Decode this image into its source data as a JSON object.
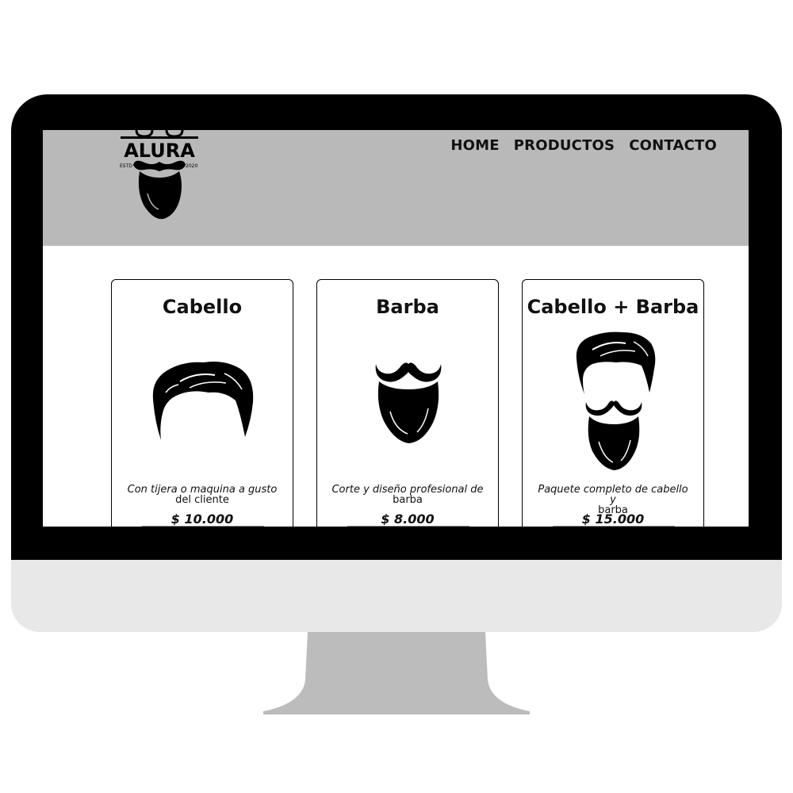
{
  "logo": {
    "brand": "ALURA",
    "estd_label": "ESTD",
    "year": "2020"
  },
  "nav": {
    "items": [
      {
        "label": "HOME"
      },
      {
        "label": "PRODUCTOS"
      },
      {
        "label": "CONTACTO"
      }
    ]
  },
  "cards": [
    {
      "title": "Cabello",
      "desc_italic": "Con tijera o maquina a gusto",
      "desc_rest": "del cliente",
      "price": "$ 10.000",
      "icon": "hair-icon"
    },
    {
      "title": "Barba",
      "desc_italic": "Corte y diseño profesional de",
      "desc_rest": "barba",
      "price": "$ 8.000",
      "icon": "beard-icon"
    },
    {
      "title": "Cabello + Barba",
      "desc_italic": "Paquete completo de cabello y",
      "desc_rest": "barba",
      "price": "$ 15.000",
      "icon": "hair-and-beard-icon"
    }
  ],
  "colors": {
    "header_bg": "#b9b9b9",
    "monitor_frame": "#000000",
    "monitor_chin": "#e8e8e8",
    "stand": "#bcbcbc"
  }
}
